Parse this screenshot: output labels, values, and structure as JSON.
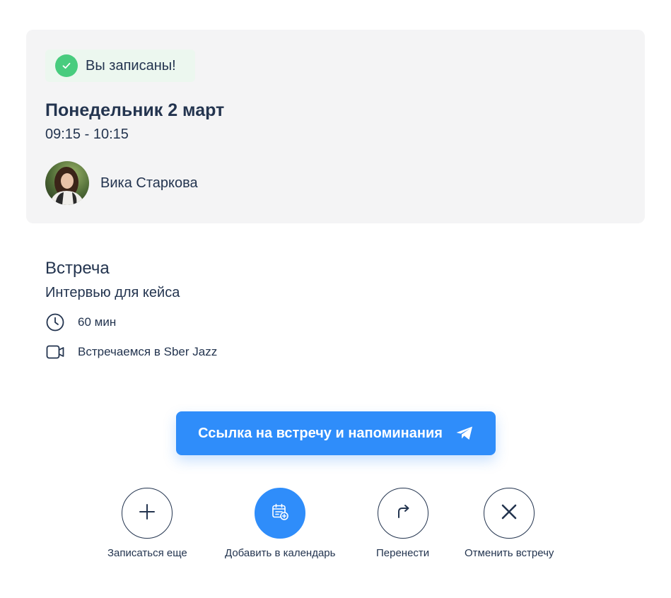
{
  "status": {
    "text": "Вы записаны!",
    "icon": "check-icon",
    "color": "#48cc7e"
  },
  "booking": {
    "date": "Понедельник 2 март",
    "time": "09:15 - 10:15",
    "host_name": "Вика Старкова"
  },
  "meeting": {
    "type": "Встреча",
    "description": "Интервью для кейса",
    "duration": "60 мин",
    "duration_icon": "clock-icon",
    "location": "Встречаемся в Sber Jazz",
    "location_icon": "video-camera-icon"
  },
  "primary_button": {
    "label": "Ссылка на встречу и напоминания",
    "icon": "telegram-icon",
    "color": "#2f8dfa"
  },
  "actions": [
    {
      "label": "Записаться еще",
      "icon": "plus-icon"
    },
    {
      "label": "Добавить в календарь",
      "icon": "calendar-add-icon"
    },
    {
      "label": "Перенести",
      "icon": "redo-arrow-icon"
    },
    {
      "label": "Отменить встречу",
      "icon": "close-icon"
    }
  ]
}
